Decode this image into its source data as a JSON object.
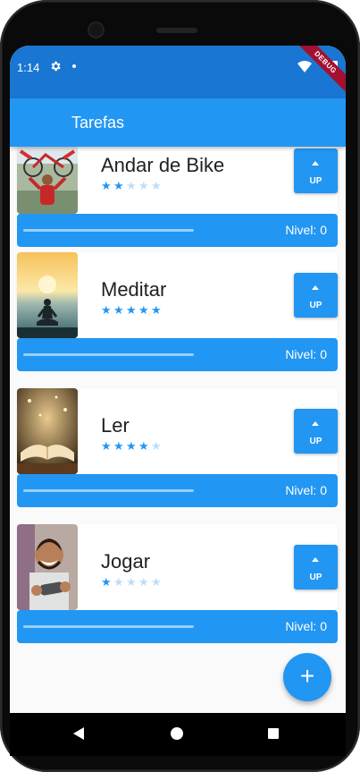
{
  "status_bar": {
    "time": "1:14",
    "icons": [
      "gear-icon",
      "dot-icon",
      "wifi-icon",
      "battery-icon"
    ],
    "debug_banner": "DEBUG"
  },
  "app_bar": {
    "title": "Tarefas"
  },
  "tasks": [
    {
      "name": "Andar de Bike",
      "rating": 2,
      "level_text": "Nivel: 0",
      "progress": 0,
      "up_label": "UP",
      "image": "cyclist-photo"
    },
    {
      "name": "Meditar",
      "rating": 5,
      "level_text": "Nivel: 0",
      "progress": 0,
      "up_label": "UP",
      "image": "meditation-photo"
    },
    {
      "name": "Ler",
      "rating": 4,
      "level_text": "Nivel: 0",
      "progress": 0,
      "up_label": "UP",
      "image": "book-photo"
    },
    {
      "name": "Jogar",
      "rating": 1,
      "level_text": "Nivel: 0",
      "progress": 0,
      "up_label": "UP",
      "image": "gamer-photo"
    }
  ],
  "fab": {
    "icon": "plus-icon",
    "label": "+"
  },
  "colors": {
    "primary": "#2196f3",
    "status_bar": "#1976d2",
    "star_on": "#2196f3",
    "star_off": "#bbdefb"
  },
  "navigation": [
    "back-icon",
    "home-icon",
    "recents-icon"
  ]
}
